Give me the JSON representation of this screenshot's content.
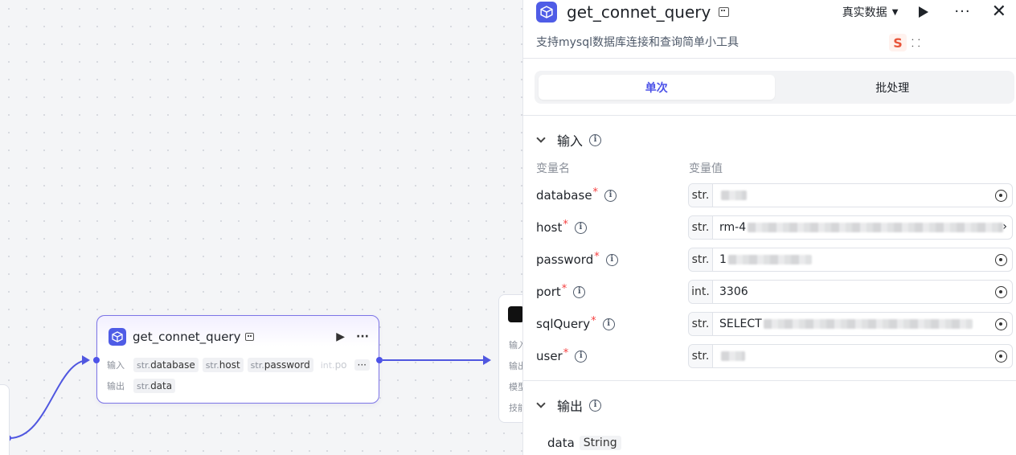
{
  "canvas": {
    "node": {
      "title": "get_connet_query",
      "input_label": "输入",
      "output_label": "输出",
      "inputs": [
        {
          "type": "str.",
          "name": "database"
        },
        {
          "type": "str.",
          "name": "host"
        },
        {
          "type": "str.",
          "name": "password"
        },
        {
          "type": "int.",
          "name": "po"
        }
      ],
      "more_label": "···",
      "outputs": [
        {
          "type": "str.",
          "name": "data"
        }
      ],
      "play_label": "▶",
      "menu_label": "···"
    },
    "right_node": {
      "labels": [
        "输入",
        "输出",
        "模型",
        "技能"
      ]
    }
  },
  "panel": {
    "title": "get_connet_query",
    "mode_select": "真实数据",
    "mode_caret": "▼",
    "play_label": "▶",
    "menu_label": "···",
    "close_label": "✕",
    "description": "支持mysql数据库连接和查询简单小工具",
    "sougou_s": "S",
    "sougou_c": "⸬",
    "tabs": [
      {
        "label": "单次",
        "active": true
      },
      {
        "label": "批处理",
        "active": false
      }
    ],
    "input_section": {
      "title": "输入",
      "col_name": "变量名",
      "col_value": "变量值",
      "rows": [
        {
          "name": "database",
          "required": "*",
          "type": "str.",
          "value": ""
        },
        {
          "name": "host",
          "required": "*",
          "type": "str.",
          "value": "rm-4"
        },
        {
          "name": "password",
          "required": "*",
          "type": "str.",
          "value": "1"
        },
        {
          "name": "port",
          "required": "*",
          "type": "int.",
          "value": "3306"
        },
        {
          "name": "sqlQuery",
          "required": "*",
          "type": "str.",
          "value": "SELECT"
        },
        {
          "name": "user",
          "required": "*",
          "type": "str.",
          "value": ""
        }
      ]
    },
    "output_section": {
      "title": "输出",
      "output_name": "data",
      "output_type": "String"
    }
  },
  "colors": {
    "accent": "#4d53e8",
    "required": "#f53f3f",
    "node_border": "#7c74e6"
  }
}
